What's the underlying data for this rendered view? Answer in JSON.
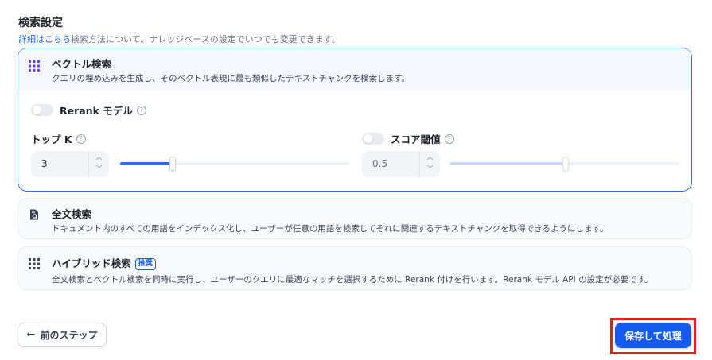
{
  "header": {
    "title": "検索設定",
    "desc_link": "詳細はこちら",
    "desc_text": "検索方法について。ナレッジベースの設定でいつでも変更できます。"
  },
  "vector": {
    "name": "ベクトル検索",
    "desc": "クエリの埋め込みを生成し、そのベクトル表現に最も類似したテキストチャンクを検索します。",
    "rerank_label": "Rerank モデル",
    "rerank_enabled": false,
    "topk_label": "トップ K",
    "topk_value": "3",
    "topk_slider_fraction": 0.23,
    "score_label": "スコア閾値",
    "score_enabled": false,
    "score_value": "0.5",
    "score_slider_fraction": 0.5,
    "icon": "grid-icon"
  },
  "fulltext": {
    "name": "全文検索",
    "desc": "ドキュメント内のすべての用語をインデックス化し、ユーザーが任意の用語を検索してそれに関連するテキストチャンクを取得できるようにします。",
    "icon": "document-search-icon"
  },
  "hybrid": {
    "name": "ハイブリッド検索",
    "badge": "推奨",
    "desc": "全文検索とベクトル検索を同時に実行し、ユーザーのクエリに最適なマッチを選択するために Rerank 付けを行います。Rerank モデル API の設定が必要です。",
    "icon": "grid-icon"
  },
  "footer": {
    "back_label": "前のステップ",
    "save_label": "保存して処理"
  },
  "colors": {
    "accent": "#155aef",
    "active_border": "#296dff",
    "highlight": "#e0201c"
  }
}
